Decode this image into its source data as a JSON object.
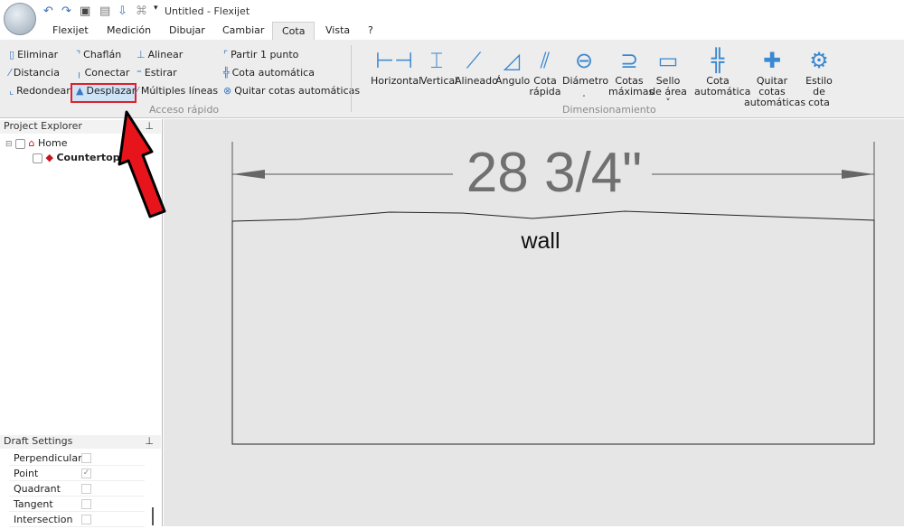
{
  "window": {
    "title": "Untitled -  Flexijet"
  },
  "tabs": [
    "Flexijet",
    "Medición",
    "Dibujar",
    "Cambiar",
    "Cota",
    "Vista",
    "?"
  ],
  "active_tab": "Cota",
  "ribbon": {
    "quick_access": {
      "label": "Acceso rápido",
      "items": [
        "Eliminar",
        "Distancia",
        "Redondear",
        "Chaflán",
        "Conectar",
        "Desplazar",
        "Alinear",
        "Estirar",
        "Múltiples líneas",
        "Partir 1 punto",
        "Cota automática",
        "Quitar cotas automáticas"
      ],
      "highlighted": "Desplazar"
    },
    "dimensioning": {
      "label": "Dimensionamiento",
      "items": [
        {
          "line1": "Horizontal",
          "line2": ""
        },
        {
          "line1": "Vertical",
          "line2": ""
        },
        {
          "line1": "Alineado",
          "line2": ""
        },
        {
          "line1": "Ángulo",
          "line2": ""
        },
        {
          "line1": "Cota",
          "line2": "rápida"
        },
        {
          "line1": "Diámetro",
          "line2": "˯"
        },
        {
          "line1": "Cotas",
          "line2": "máximas"
        },
        {
          "line1": "Sello",
          "line2": "de área ˅"
        },
        {
          "line1": "Cota",
          "line2": "automática"
        },
        {
          "line1": "Quitar cotas",
          "line2": "automáticas"
        },
        {
          "line1": "Estilo",
          "line2": "de cota"
        }
      ]
    }
  },
  "project_explorer": {
    "title": "Project Explorer",
    "items": [
      "Home",
      "Countertop"
    ]
  },
  "draft_settings": {
    "title": "Draft Settings",
    "rows": [
      {
        "label": "Perpendicular",
        "checked": false
      },
      {
        "label": "Point",
        "checked": true
      },
      {
        "label": "Quadrant",
        "checked": false
      },
      {
        "label": "Tangent",
        "checked": false
      },
      {
        "label": "Intersection",
        "checked": false
      }
    ]
  },
  "drawing": {
    "dimension": "28 3/4\"",
    "label": "wall"
  },
  "colors": {
    "highlight": "#e0202a",
    "accent": "#3a88d0",
    "arrow": "#e8141c"
  }
}
